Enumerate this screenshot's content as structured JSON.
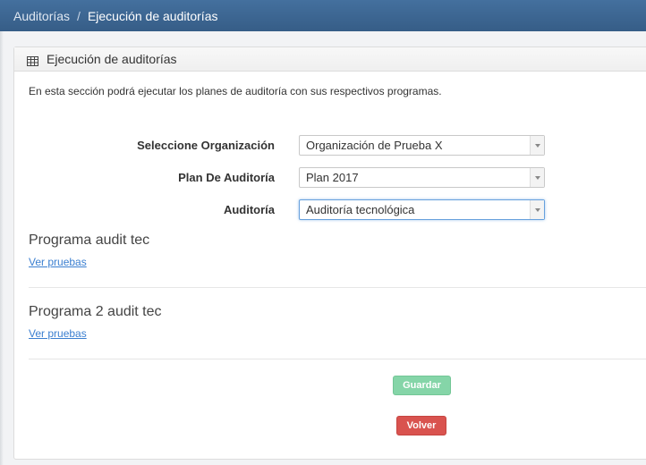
{
  "breadcrumb": {
    "parent": "Auditorías",
    "separator": "/",
    "current": "Ejecución de auditorías"
  },
  "panel": {
    "title": "Ejecución de auditorías",
    "icon": "table-icon",
    "intro": "En esta sección podrá ejecutar los planes de auditoría con sus respectivos programas."
  },
  "form": {
    "organization": {
      "label": "Seleccione Organización",
      "value": "Organización de Prueba X"
    },
    "plan": {
      "label": "Plan De Auditoría",
      "value": "Plan 2017"
    },
    "audit": {
      "label": "Auditoría",
      "value": "Auditoría tecnológica"
    }
  },
  "programs": [
    {
      "title": "Programa audit tec",
      "link": "Ver pruebas"
    },
    {
      "title": "Programa 2 audit tec",
      "link": "Ver pruebas"
    }
  ],
  "buttons": {
    "save": "Guardar",
    "back": "Volver"
  },
  "colors": {
    "topbar": "#3c6591",
    "save": "#7fd3a4",
    "back": "#d9534f",
    "link": "#3b7fd0"
  }
}
